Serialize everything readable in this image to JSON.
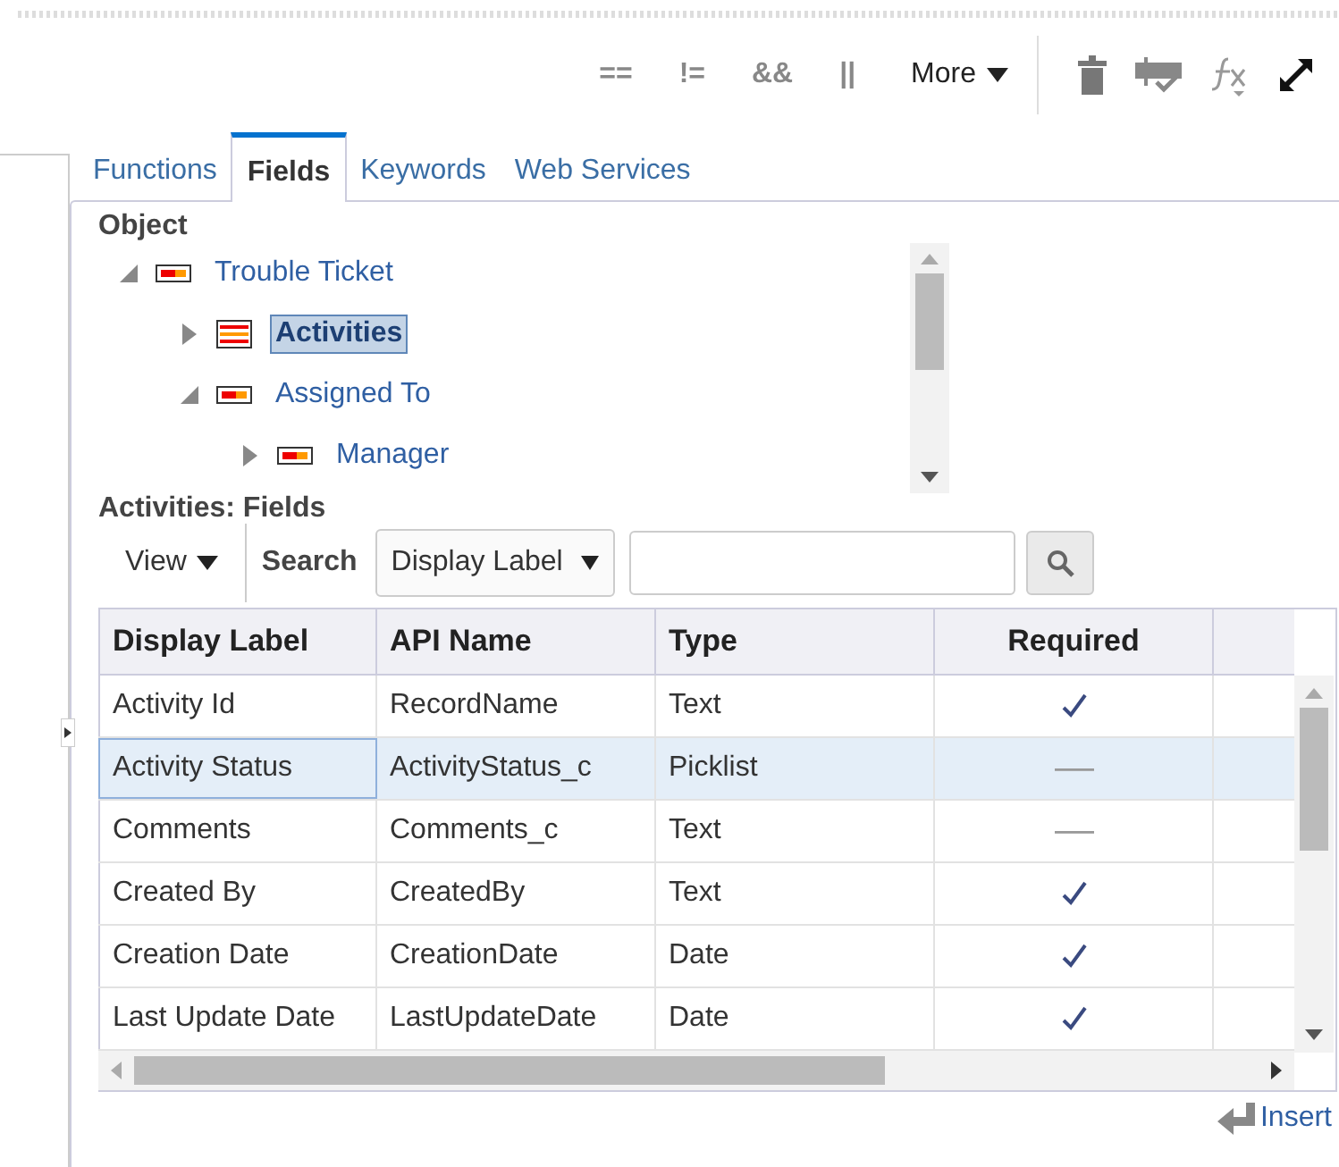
{
  "toolbar": {
    "operators": [
      "==",
      "!=",
      "&&",
      "||"
    ],
    "more": "More"
  },
  "tabs": [
    {
      "label": "Functions",
      "selected": false
    },
    {
      "label": "Fields",
      "selected": true
    },
    {
      "label": "Keywords",
      "selected": false
    },
    {
      "label": "Web Services",
      "selected": false
    }
  ],
  "object_tree": {
    "title": "Object",
    "items": [
      {
        "label": "Trouble Ticket",
        "expanded": true,
        "selected": false,
        "children": [
          {
            "label": "Activities",
            "expanded": false,
            "selected": true
          },
          {
            "label": "Assigned To",
            "expanded": true,
            "selected": false,
            "children": [
              {
                "label": "Manager",
                "expanded": false,
                "selected": false
              }
            ]
          }
        ]
      }
    ]
  },
  "fields": {
    "title": "Activities: Fields",
    "view": "View",
    "search_label": "Search",
    "search_by": "Display Label",
    "columns": [
      "Display Label",
      "API Name",
      "Type",
      "Required"
    ],
    "rows": [
      {
        "display_label": "Activity Id",
        "api_name": "RecordName",
        "type": "Text",
        "required": true,
        "selected": false
      },
      {
        "display_label": "Activity Status",
        "api_name": "ActivityStatus_c",
        "type": "Picklist",
        "required": false,
        "selected": true
      },
      {
        "display_label": "Comments",
        "api_name": "Comments_c",
        "type": "Text",
        "required": false,
        "selected": false
      },
      {
        "display_label": "Created By",
        "api_name": "CreatedBy",
        "type": "Text",
        "required": true,
        "selected": false
      },
      {
        "display_label": "Creation Date",
        "api_name": "CreationDate",
        "type": "Date",
        "required": true,
        "selected": false
      },
      {
        "display_label": "Last Update Date",
        "api_name": "LastUpdateDate",
        "type": "Date",
        "required": true,
        "selected": false
      }
    ]
  },
  "insert": "Insert"
}
